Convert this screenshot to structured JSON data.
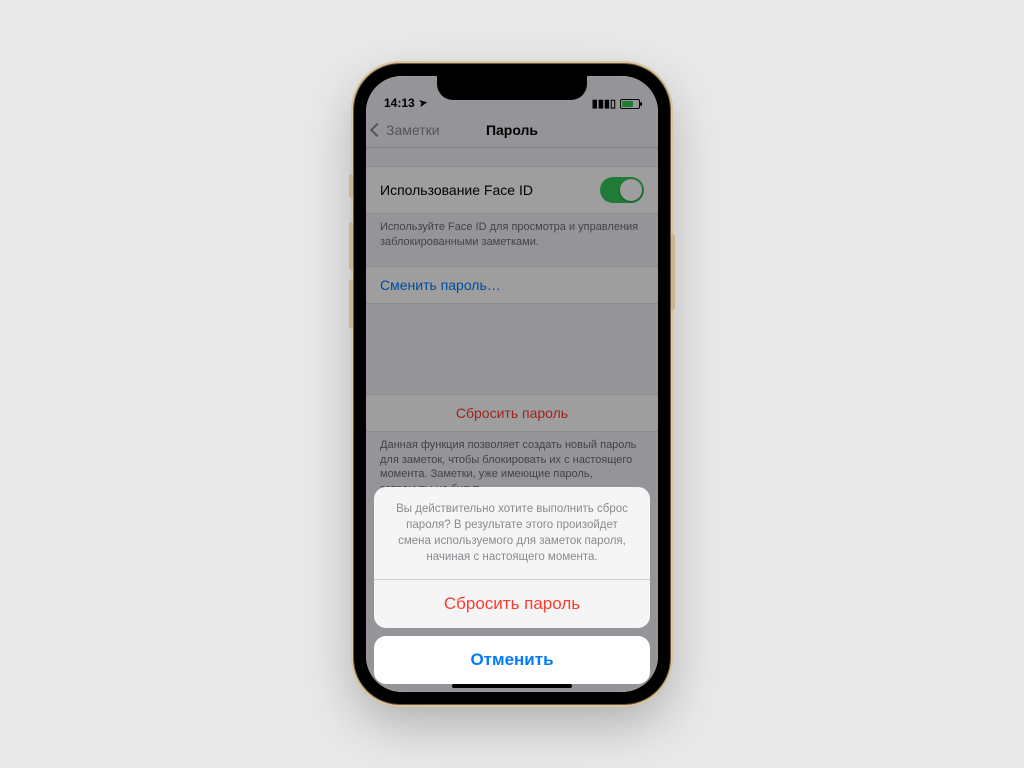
{
  "statusbar": {
    "time": "14:13",
    "location_icon": "location-arrow",
    "signal_icon": "cellular",
    "battery_icon": "battery-charging"
  },
  "nav": {
    "back_label": "Заметки",
    "title": "Пароль"
  },
  "settings": {
    "face_id": {
      "label": "Использование Face ID",
      "on": true,
      "help": "Используйте Face ID для просмотра и управления заблокированными заметками."
    },
    "change_password_label": "Сменить пароль…",
    "reset_password_label": "Сбросить пароль",
    "reset_password_help": "Данная функция позволяет создать новый пароль для заметок, чтобы блокировать их с настоящего момента. Заметки, уже имеющие пароль, затронуты не будут."
  },
  "sheet": {
    "message": "Вы действительно хотите выполнить сброс пароля? В результате этого произойдет смена используемого для заметок пароля, начиная с настоящего момента.",
    "confirm": "Сбросить пароль",
    "cancel": "Отменить"
  },
  "colors": {
    "accent_blue": "#007aff",
    "destructive_red": "#ff3b30",
    "toggle_green": "#34c759"
  }
}
